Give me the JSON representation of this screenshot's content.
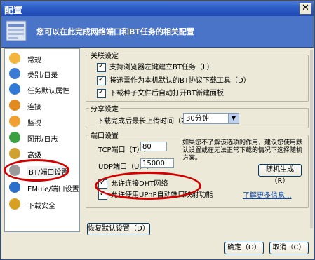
{
  "window": {
    "title": "配置",
    "close_glyph": "✕"
  },
  "banner": {
    "text": "您可以在此完成网络端口和BT任务的相关配置"
  },
  "sidebar": {
    "items": [
      {
        "label": "常规",
        "icon": "general-icon",
        "color": "#e8a020"
      },
      {
        "label": "类别/目录",
        "icon": "folder-icon",
        "color": "#3a7bd5"
      },
      {
        "label": "任务默认属性",
        "icon": "task-icon",
        "color": "#2f7ad6"
      },
      {
        "label": "连接",
        "icon": "connection-icon",
        "color": "#e08a20"
      },
      {
        "label": "监视",
        "icon": "monitor-icon",
        "color": "#f0a030"
      },
      {
        "label": "图形/日志",
        "icon": "chart-icon",
        "color": "#3aa040"
      },
      {
        "label": "高级",
        "icon": "advanced-icon",
        "color": "#d0a030"
      },
      {
        "label": "BT/端口设置",
        "icon": "bt-icon",
        "color": "#9a9a9a"
      },
      {
        "label": "EMule/端口设置",
        "icon": "emule-icon",
        "color": "#2a6fc9"
      },
      {
        "label": "下载安全",
        "icon": "security-icon",
        "color": "#d8a020"
      }
    ]
  },
  "association": {
    "legend": "关联设定",
    "items": [
      "支持浏览器左键建立BT任务（L）",
      "将迅雷作为本机默认的BT协议下载工具（D）",
      "下载种子文件后自动打开BT新建面板"
    ]
  },
  "share": {
    "legend": "分享设定",
    "label": "下载完成后最长上传时间（Z）:",
    "value": "30分钟"
  },
  "port": {
    "legend": "端口设置",
    "tcp_label": "TCP端口（T）:",
    "tcp_value": "80",
    "udp_label": "UDP端口（U）:",
    "udp_value": "15000",
    "hint": "如果您不了解该选项的作用，建议您使用默认设置或在无法正常下载的情况下选择随机方案。",
    "random_button": "随机生成（R）",
    "dht": "允许连接DHT网络",
    "upnp": "允许使用UPnP自动端口映射功能",
    "learn_more": "了解更多信息..."
  },
  "restore_button": "恢复默认设置（D）",
  "ok_button": "确定（O）",
  "cancel_button": "取消（C）",
  "accent": "#d40000"
}
